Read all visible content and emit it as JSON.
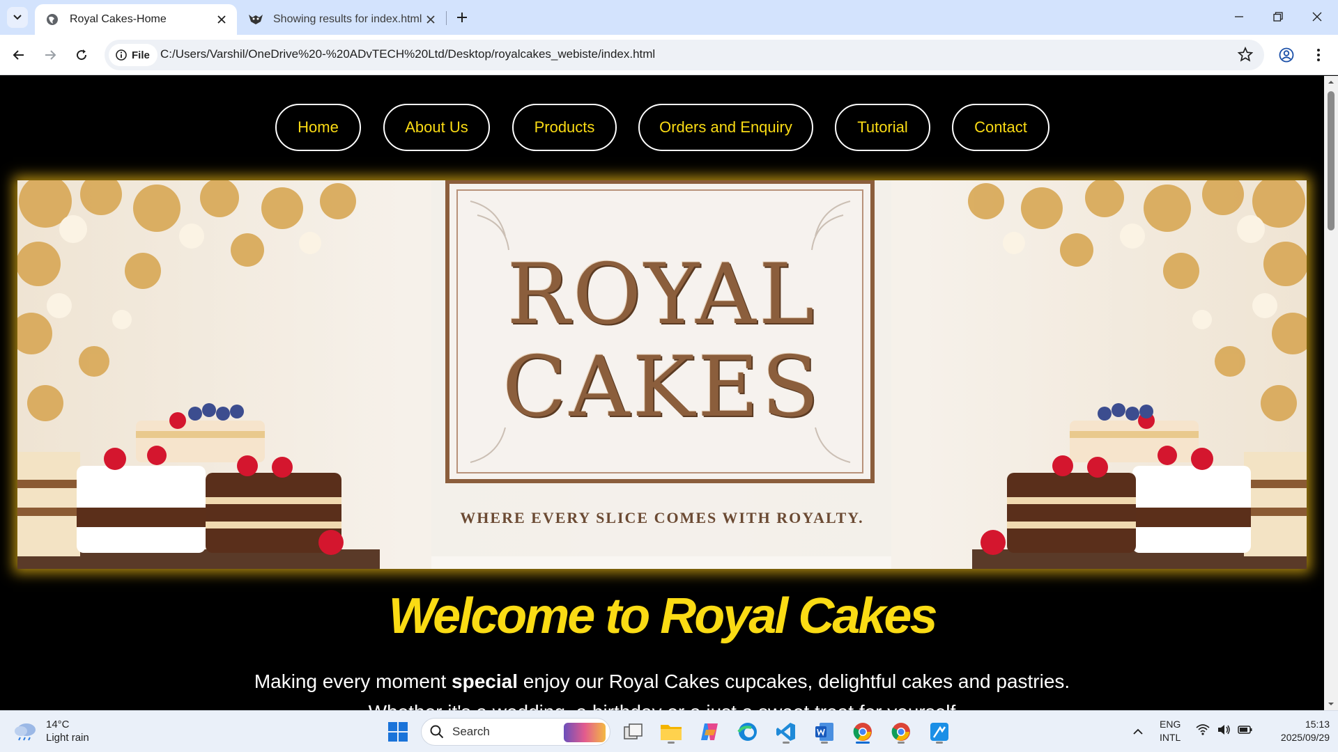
{
  "browser": {
    "tabs": [
      {
        "title": "Royal Cakes-Home",
        "active": true
      },
      {
        "title": "Showing results for index.html",
        "active": false
      }
    ],
    "site_chip": "File",
    "url": "C:/Users/Varshil/OneDrive%20-%20ADvTECH%20Ltd/Desktop/royalcakes_webiste/index.html"
  },
  "site": {
    "nav": [
      "Home",
      "About Us",
      "Products",
      "Orders and Enquiry",
      "Tutorial",
      "Contact"
    ],
    "banner": {
      "line1": "ROYAL",
      "line2": "CAKES",
      "tagline": "WHERE EVERY SLICE COMES WITH ROYALTY."
    },
    "welcome": "Welcome to Royal Cakes",
    "intro_before": "Making every moment ",
    "intro_bold": "special",
    "intro_after": " enjoy our Royal Cakes cupcakes, delightful cakes and pastries.",
    "intro_line2": "Whether it's a wedding, a birthday or a just a sweet treat for yourself",
    "accent_color": "#fadb14"
  },
  "taskbar": {
    "weather_temp": "14°C",
    "weather_desc": "Light rain",
    "search_placeholder": "Search",
    "lang_line1": "ENG",
    "lang_line2": "INTL",
    "time": "15:13",
    "date": "2025/09/29"
  }
}
